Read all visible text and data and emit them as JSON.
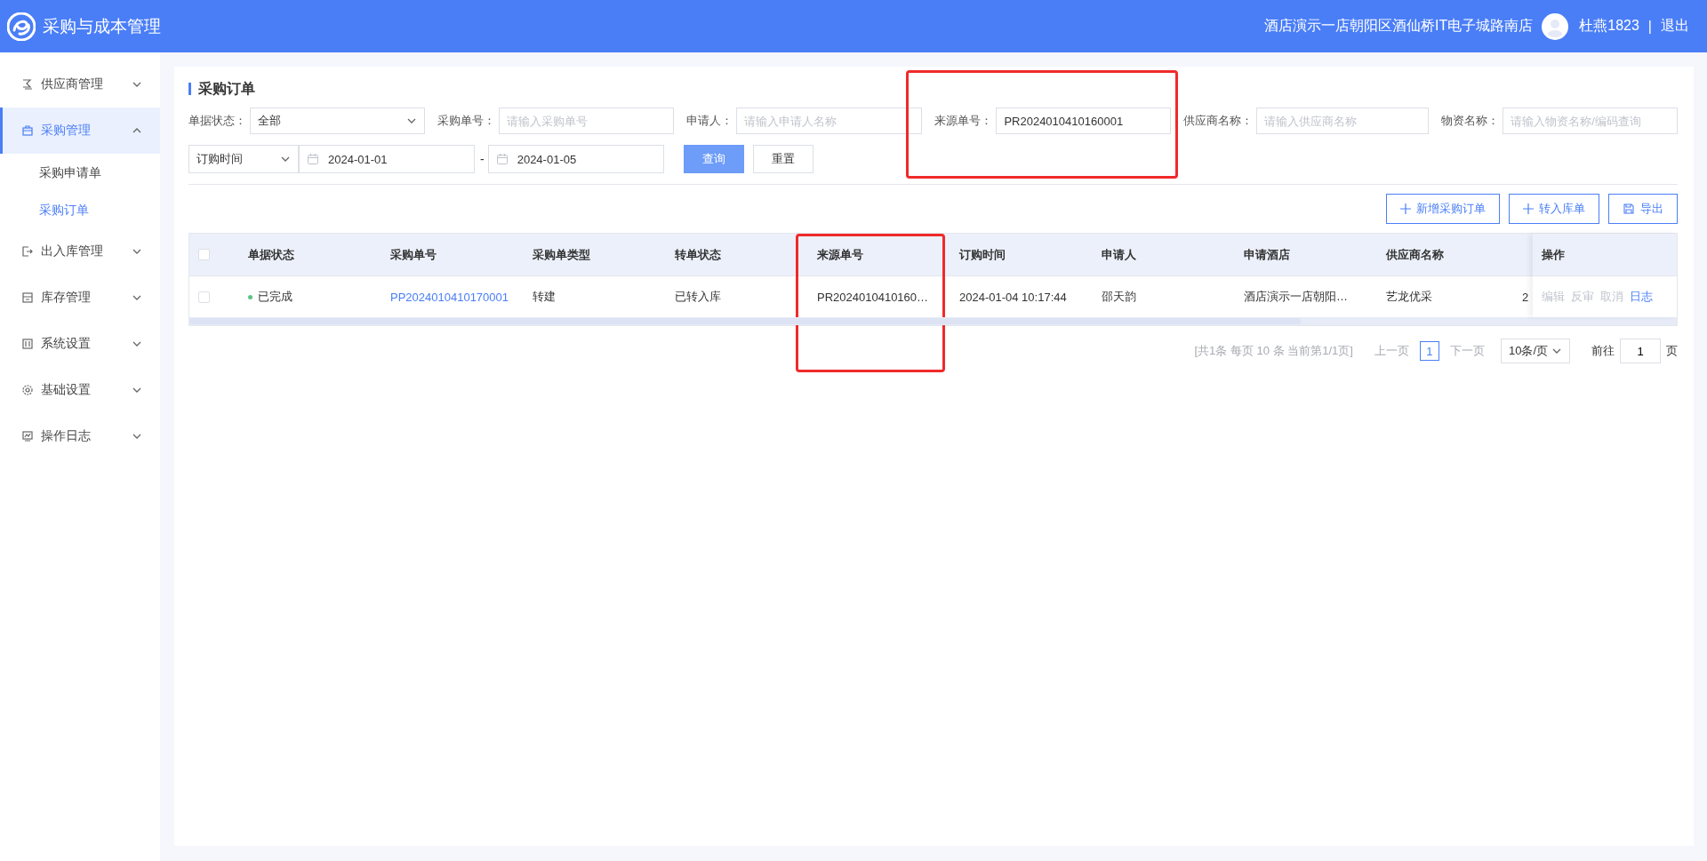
{
  "header": {
    "title": "采购与成本管理",
    "store": "酒店演示一店朝阳区酒仙桥IT电子城路南店",
    "user": "杜燕1823",
    "separator": "|",
    "logout": "退出"
  },
  "sidebar": {
    "items": [
      {
        "label": "供应商管理",
        "expanded": false,
        "selected": false
      },
      {
        "label": "采购管理",
        "expanded": true,
        "selected": true,
        "children": [
          {
            "label": "采购申请单",
            "selected": false
          },
          {
            "label": "采购订单",
            "selected": true
          }
        ]
      },
      {
        "label": "出入库管理",
        "expanded": false,
        "selected": false
      },
      {
        "label": "库存管理",
        "expanded": false,
        "selected": false
      },
      {
        "label": "系统设置",
        "expanded": false,
        "selected": false
      },
      {
        "label": "基础设置",
        "expanded": false,
        "selected": false
      },
      {
        "label": "操作日志",
        "expanded": false,
        "selected": false
      }
    ]
  },
  "page": {
    "title": "采购订单"
  },
  "filters": [
    {
      "kind": "select",
      "label": "单据状态：",
      "value": "全部",
      "highlighted": false
    },
    {
      "kind": "input",
      "label": "采购单号：",
      "placeholder": "请输入采购单号",
      "highlighted": false
    },
    {
      "kind": "input",
      "label": "申请人：",
      "placeholder": "请输入申请人名称",
      "highlighted": false
    },
    {
      "kind": "input",
      "label": "来源单号：",
      "value": "PR2024010410160001",
      "highlighted": true
    },
    {
      "kind": "input",
      "label": "供应商名称：",
      "placeholder": "请输入供应商名称",
      "highlighted": false
    },
    {
      "kind": "input",
      "label": "物资名称：",
      "placeholder": "请输入物资名称/编码查询",
      "highlighted": false
    }
  ],
  "date_filter": {
    "type": "订购时间",
    "from": "2024-01-01",
    "separator": "-",
    "to": "2024-01-05"
  },
  "search_buttons": [
    {
      "label": "查询",
      "kind": "primary"
    },
    {
      "label": "重置",
      "kind": "default"
    }
  ],
  "toolbar": [
    {
      "label": "新增采购订单",
      "kind": "add"
    },
    {
      "label": "转入库单",
      "kind": "add"
    },
    {
      "label": "导出",
      "kind": "export"
    }
  ],
  "table": {
    "select_all_checked": false,
    "columns": [
      {
        "label": "单据状态",
        "highlighted": false
      },
      {
        "label": "采购单号",
        "highlighted": false
      },
      {
        "label": "采购单类型",
        "highlighted": false
      },
      {
        "label": "转单状态",
        "highlighted": false
      },
      {
        "label": "来源单号",
        "highlighted": true
      },
      {
        "label": "订购时间",
        "highlighted": false
      },
      {
        "label": "申请人",
        "highlighted": false
      },
      {
        "label": "申请酒店",
        "highlighted": false
      },
      {
        "label": "供应商名称",
        "highlighted": false
      }
    ],
    "actions_header": "操作",
    "rows": [
      {
        "checked": false,
        "cells": [
          {
            "kind": "status",
            "text": "已完成",
            "color": "#5cc483"
          },
          {
            "kind": "link",
            "text": "PP2024010410170001"
          },
          {
            "kind": "text",
            "text": "转建"
          },
          {
            "kind": "text",
            "text": "已转入库"
          },
          {
            "kind": "text",
            "text": "PR2024010410160…"
          },
          {
            "kind": "text",
            "text": "2024-01-04 10:17:44"
          },
          {
            "kind": "text",
            "text": "邵天韵"
          },
          {
            "kind": "text",
            "text": "酒店演示一店朝阳…"
          },
          {
            "kind": "text",
            "text": "艺龙优采"
          },
          {
            "kind": "text",
            "text": "2"
          }
        ],
        "actions": [
          {
            "label": "编辑",
            "disabled": true
          },
          {
            "label": "反审",
            "disabled": true
          },
          {
            "label": "取消",
            "disabled": true
          },
          {
            "label": "日志",
            "disabled": false
          }
        ]
      }
    ]
  },
  "pagination": {
    "summary": "[共1条 每页 10 条 当前第1/1页]",
    "prev": {
      "label": "上一页",
      "disabled": true
    },
    "pages": [
      {
        "label": "1",
        "selected": true
      }
    ],
    "next": {
      "label": "下一页",
      "disabled": true
    },
    "page_size": "10条/页",
    "goto_label": "前往",
    "goto_value": "1",
    "goto_suffix": "页"
  }
}
